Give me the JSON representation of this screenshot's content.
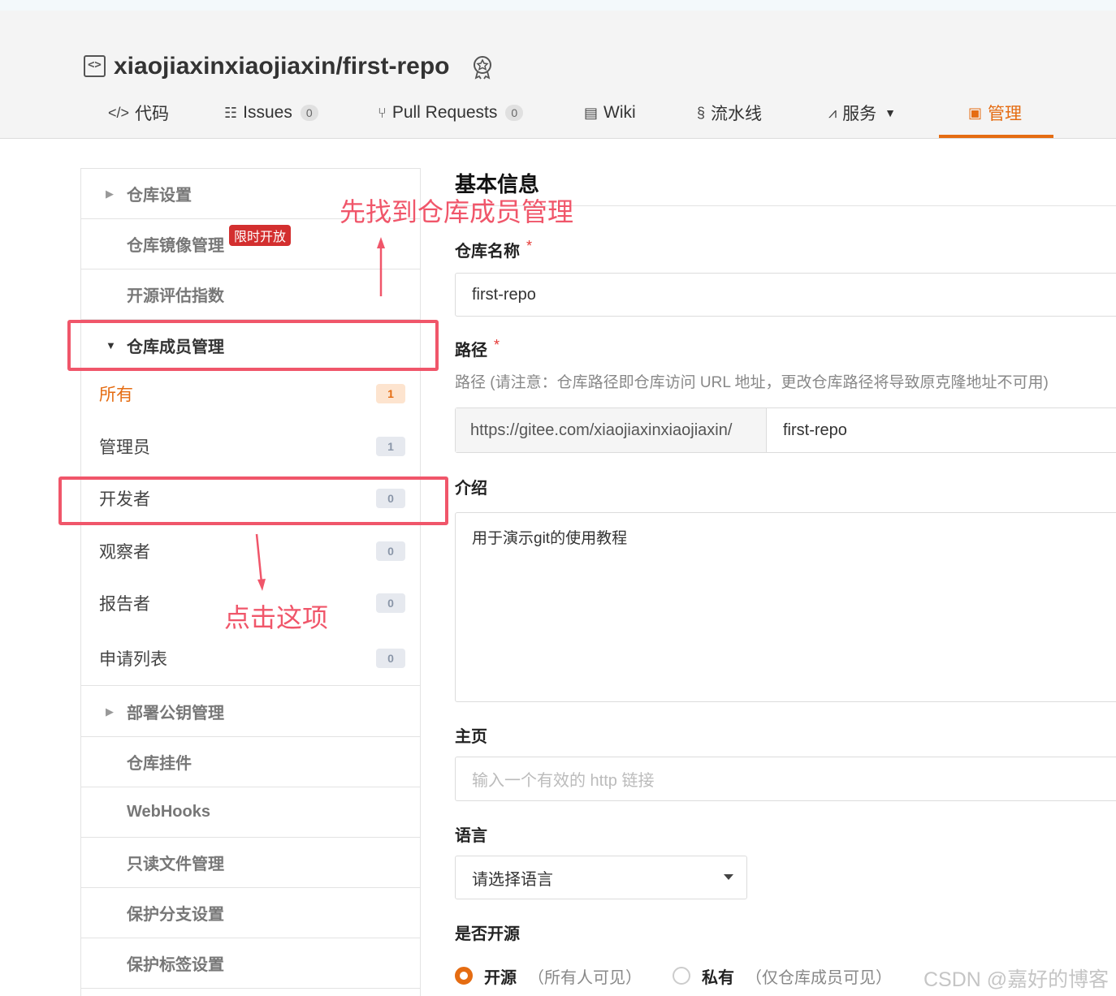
{
  "repo": {
    "title": "xiaojiaxinxiaojiaxin/first-repo"
  },
  "tabs": [
    {
      "label": "代码",
      "icon": "code-icon"
    },
    {
      "label": "Issues",
      "count": "0",
      "icon": "issues-icon"
    },
    {
      "label": "Pull Requests",
      "count": "0",
      "icon": "pull-request-icon"
    },
    {
      "label": "Wiki",
      "icon": "wiki-icon"
    },
    {
      "label": "流水线",
      "icon": "pipeline-icon"
    },
    {
      "label": "服务",
      "icon": "service-icon"
    },
    {
      "label": "管理",
      "icon": "manage-icon",
      "active": true
    }
  ],
  "sidebar": {
    "repo_settings": "仓库设置",
    "mirror": "仓库镜像管理",
    "limited_tag": "限时开放",
    "oss_index": "开源评估指数",
    "members": "仓库成员管理",
    "member_items": [
      {
        "label": "所有",
        "count": "1"
      },
      {
        "label": "管理员",
        "count": "1"
      },
      {
        "label": "开发者",
        "count": "0"
      },
      {
        "label": "观察者",
        "count": "0"
      },
      {
        "label": "报告者",
        "count": "0"
      },
      {
        "label": "申请列表",
        "count": "0"
      }
    ],
    "deploy_keys": "部署公钥管理",
    "plugins": "仓库挂件",
    "webhooks": "WebHooks",
    "readonly_files": "只读文件管理",
    "protected_branches": "保护分支设置",
    "protected_tags": "保护标签设置"
  },
  "form": {
    "section_title": "基本信息",
    "name_label": "仓库名称",
    "required_mark": "*",
    "name_value": "first-repo",
    "path_label": "路径",
    "path_hint": "路径 (请注意：仓库路径即仓库访问 URL 地址，更改仓库路径将导致原克隆地址不可用)",
    "path_prefix": "https://gitee.com/xiaojiaxinxiaojiaxin/",
    "path_value": "first-repo",
    "intro_label": "介绍",
    "intro_value": "用于演示git的使用教程",
    "homepage_label": "主页",
    "homepage_placeholder": "输入一个有效的 http 链接",
    "language_label": "语言",
    "language_value": "请选择语言",
    "open_label": "是否开源",
    "open_option": "开源",
    "open_hint": "（所有人可见）",
    "private_option": "私有",
    "private_hint": "（仅仓库成员可见）"
  },
  "annotations": {
    "find_members": "先找到仓库成员管理",
    "click_this": "点击这项"
  },
  "watermark": "CSDN @嘉好的博客",
  "colors": {
    "accent": "#e56c12",
    "annotation": "#f0566a",
    "limited_tag": "#d32f2f"
  }
}
